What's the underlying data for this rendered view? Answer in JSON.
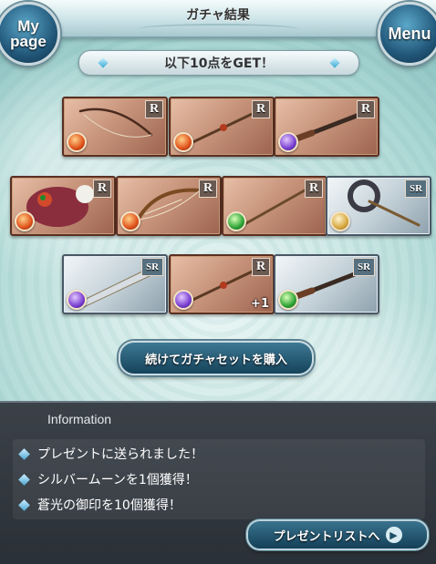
{
  "header": {
    "title": "ガチャ結果",
    "mypage_label": "My page",
    "menu_label": "Menu"
  },
  "result_banner": "以下10点をGET！",
  "items": [
    {
      "rarity": "R",
      "element": "fire",
      "weapon": "bow",
      "plus": ""
    },
    {
      "rarity": "R",
      "element": "fire",
      "weapon": "spear",
      "plus": ""
    },
    {
      "rarity": "R",
      "element": "dark",
      "weapon": "gun",
      "plus": ""
    },
    {
      "rarity": "R",
      "element": "fire",
      "weapon": "summon",
      "plus": ""
    },
    {
      "rarity": "R",
      "element": "fire",
      "weapon": "harp",
      "plus": ""
    },
    {
      "rarity": "R",
      "element": "wind",
      "weapon": "staff",
      "plus": ""
    },
    {
      "rarity": "SR",
      "element": "light",
      "weapon": "axe",
      "plus": ""
    },
    {
      "rarity": "SR",
      "element": "dark",
      "weapon": "sword",
      "plus": ""
    },
    {
      "rarity": "R",
      "element": "dark",
      "weapon": "spear",
      "plus": "+1"
    },
    {
      "rarity": "SR",
      "element": "wind",
      "weapon": "gun",
      "plus": ""
    }
  ],
  "buy_button": "続けてガチャセットを購入",
  "information": {
    "title": "Information",
    "lines": [
      "プレゼントに送られました！",
      "シルバームーンを1個獲得！",
      "蒼光の御印を10個獲得！"
    ],
    "present_button": "プレゼントリストへ"
  }
}
